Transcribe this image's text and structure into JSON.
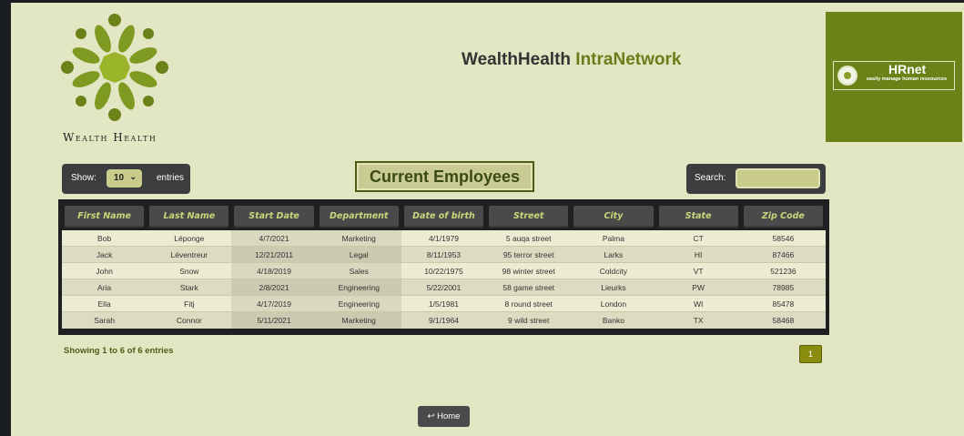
{
  "brand": {
    "logo_text": "Wealth Health",
    "title_main": "WealthHealth",
    "title_accent": "IntraNetwork",
    "logo_icon": "wealth-health-flower-icon",
    "accent_color": "#6b7d1a"
  },
  "hrnet": {
    "name": "HRnet",
    "tagline": "easily manage human ressources",
    "background_color": "#6b8219"
  },
  "controls": {
    "show_label": "Show:",
    "entries_selected": "10",
    "entries_label": "entries",
    "search_label": "Search:",
    "search_value": ""
  },
  "heading": "Current Employees",
  "table": {
    "columns": [
      "First Name",
      "Last Name",
      "Start Date",
      "Department",
      "Date of birth",
      "Street",
      "City",
      "State",
      "Zip Code"
    ],
    "rows": [
      [
        "Bob",
        "Léponge",
        "4/7/2021",
        "Marketing",
        "4/1/1979",
        "5 auqa street",
        "Palma",
        "CT",
        "58546"
      ],
      [
        "Jack",
        "Léventreur",
        "12/21/2011",
        "Legal",
        "8/11/1953",
        "95 terror street",
        "Larks",
        "HI",
        "87466"
      ],
      [
        "John",
        "Snow",
        "4/18/2019",
        "Sales",
        "10/22/1975",
        "98 winter street",
        "Coldcity",
        "VT",
        "521236"
      ],
      [
        "Aria",
        "Stark",
        "2/8/2021",
        "Engineering",
        "5/22/2001",
        "58 game street",
        "Lieurks",
        "PW",
        "78985"
      ],
      [
        "Ella",
        "Fitj",
        "4/17/2019",
        "Engineering",
        "1/5/1981",
        "8 round street",
        "London",
        "WI",
        "85478"
      ],
      [
        "Sarah",
        "Connor",
        "5/11/2021",
        "Marketing",
        "9/1/1964",
        "9 wild street",
        "Banko",
        "TX",
        "58468"
      ]
    ]
  },
  "footer": {
    "info": "Showing 1 to 6 of 6 entries",
    "current_page": "1",
    "home_label": "↩ Home"
  }
}
